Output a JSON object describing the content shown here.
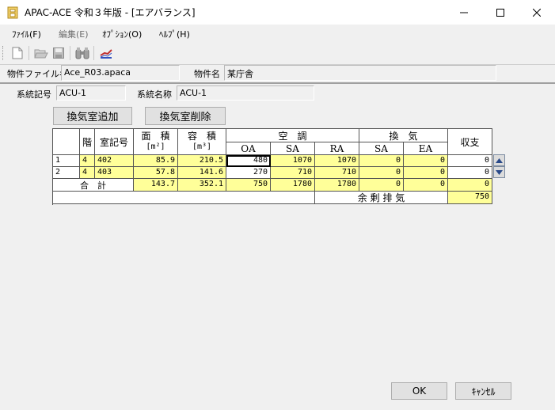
{
  "window": {
    "title": "APAC-ACE 令和３年版 - [エアバランス]",
    "controls": [
      "minimize-icon",
      "maximize-icon",
      "close-icon"
    ]
  },
  "menu": {
    "items": [
      {
        "label": "ﾌｧｲﾙ(F)",
        "enabled": true
      },
      {
        "label": "編集(E)",
        "enabled": false
      },
      {
        "label": "ｵﾌﾟｼｮﾝ(O)",
        "enabled": true
      },
      {
        "label": "ﾍﾙﾌﾟ(H)",
        "enabled": true
      }
    ]
  },
  "toolbar": {
    "buttons": [
      "new-file-icon",
      "open-folder-icon",
      "save-icon",
      "binoculars-icon",
      "chart-icon"
    ]
  },
  "property": {
    "file_label": "物件ファイル名",
    "file_value": "Ace_R03.apaca",
    "name_label": "物件名",
    "name_value": "某庁舎"
  },
  "system": {
    "code_label": "系統記号",
    "code_value": "ACU-1",
    "name_label": "系統名称",
    "name_value": "ACU-1"
  },
  "buttons": {
    "add_room": "換気室追加",
    "delete_room": "換気室削除",
    "ok": "OK",
    "cancel": "ｷｬﾝｾﾙ"
  },
  "grid": {
    "headers": {
      "floor": "階",
      "room": "室記号",
      "area": "面　積",
      "area_unit": "[m²]",
      "volume": "容　積",
      "volume_unit": "[m³]",
      "ac": "空　調",
      "vent": "換　気",
      "balance": "収支",
      "oa": "OA",
      "sa": "SA",
      "ra": "RA",
      "vsa": "SA",
      "ea": "EA"
    },
    "rows": [
      {
        "no": "1",
        "floor": "4",
        "room": "402",
        "area": "85.9",
        "volume": "210.5",
        "oa": "480",
        "sa": "1070",
        "ra": "1070",
        "vsa": "0",
        "ea": "0",
        "balance": "0"
      },
      {
        "no": "2",
        "floor": "4",
        "room": "403",
        "area": "57.8",
        "volume": "141.6",
        "oa": "270",
        "sa": "710",
        "ra": "710",
        "vsa": "0",
        "ea": "0",
        "balance": "0"
      }
    ],
    "total": {
      "label": "合　計",
      "area": "143.7",
      "volume": "352.1",
      "oa": "750",
      "sa": "1780",
      "ra": "1780",
      "vsa": "0",
      "ea": "0",
      "balance": "0"
    },
    "surplus": {
      "label": "余 剰 排 気",
      "value": "750"
    }
  },
  "colors": {
    "yellow": "#ffff99",
    "white": "#ffffff"
  }
}
